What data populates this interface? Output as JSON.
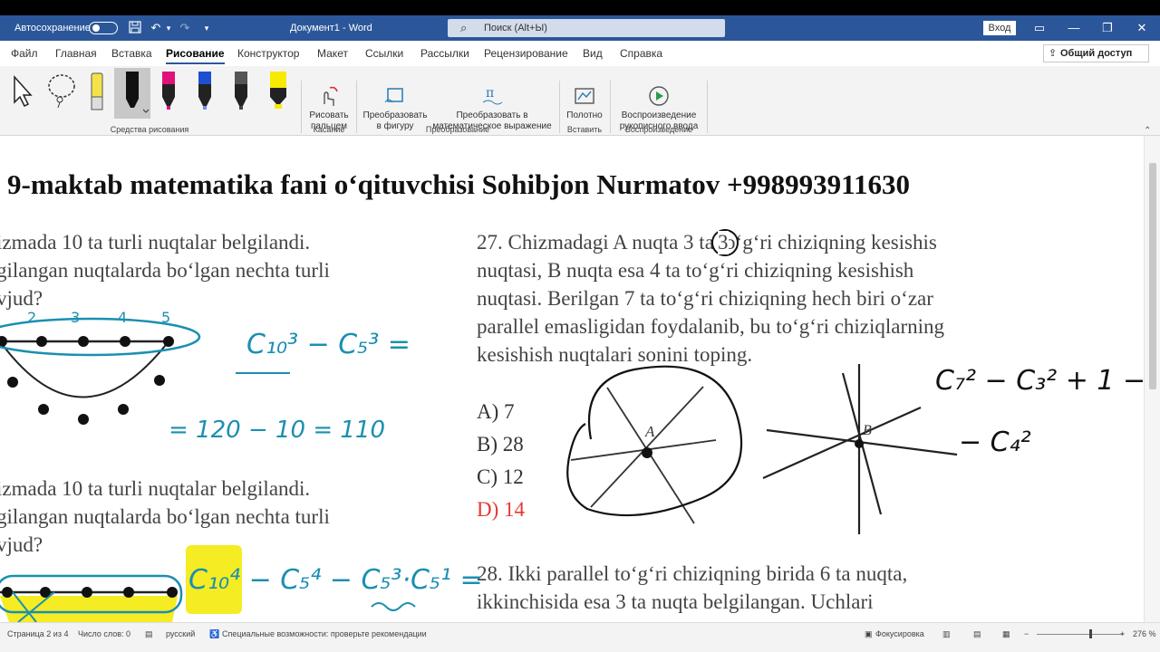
{
  "titlebar": {
    "autosave_label": "Автосохранение",
    "doc_title": "Документ1  -  Word",
    "search_placeholder": "Поиск (Alt+Ы)",
    "signin_label": "Вход"
  },
  "tabs": [
    "Файл",
    "Главная",
    "Вставка",
    "Рисование",
    "Конструктор",
    "Макет",
    "Ссылки",
    "Рассылки",
    "Рецензирование",
    "Вид",
    "Справка"
  ],
  "active_tab": "Рисование",
  "share_label": "Общий доступ",
  "ribbon": {
    "group_drawing_tools": "Средства рисования",
    "draw_with_finger": "Рисовать\nпальцем",
    "group_touch": "Касание",
    "convert_to_shape": "Преобразовать\nв фигуру",
    "convert_to_math": "Преобразовать в\nматематическое выражение",
    "group_convert": "Преобразование",
    "canvas_label": "Полотно",
    "group_insert": "Вставить",
    "ink_replay": "Воспроизведение\nрукописного ввода",
    "group_replay": "Воспроизведение",
    "pen_colors": [
      "#f3e24a",
      "#111111",
      "#e0117a",
      "#1e4fd1",
      "#222222",
      "#f7ea00"
    ]
  },
  "document": {
    "heading": "9-maktab matematika fani o‘qituvchisi Sohibjon Nurmatov +998993911630",
    "left_q1_lines": [
      "izmada 10 ta turli nuqtalar belgilandi.",
      "gilangan nuqtalarda bo‘lgan nechta turli",
      "vjud?"
    ],
    "left_q2_lines": [
      "izmada 10 ta turli nuqtalar belgilandi.",
      "gilangan nuqtalarda bo‘lgan nechta turli",
      "vjud?"
    ],
    "q27_lines": [
      "27. Chizmadagi A nuqta 3 ta to‘g‘ri chiziqning kesishis",
      "nuqtasi, B nuqta esa 4 ta to‘g‘ri chiziqning kesishish",
      "nuqtasi. Berilgan 7 ta to‘g‘ri chiziqning hech biri o‘zar",
      "parallel emasligidan foydalanib, bu to‘g‘ri chiziqlarning",
      "kesishish nuqtalari sonini toping."
    ],
    "answers": [
      "A) 7",
      "B) 28",
      "C) 12",
      "D) 14"
    ],
    "q28_lines": [
      "28. Ikki parallel to‘g‘ri chiziqning birida 6 ta nuqta,",
      "ikkinchisida esa 3 ta nuqta belgilangan. Uchlari"
    ],
    "figure_label_a": "A",
    "figure_label_b": "B",
    "diagram_numbers": [
      "2",
      "3",
      "4",
      "5"
    ],
    "ink_text": {
      "left_formula": "C₁₀³ − C₅³ =",
      "left_result": "= 120 − 10 = 110",
      "bottom_formula": "C₁₀⁴ − C₅⁴ − C₅³·C₅¹ =",
      "right_formula_1": "C₇² − C₃² + 1 −",
      "right_formula_2": "− C₄²",
      "circled_number": "3"
    }
  },
  "statusbar": {
    "page": "Страница 2 из 4",
    "words": "Число слов: 0",
    "language": "русский",
    "accessibility": "Специальные возможности: проверьте рекомендации",
    "focus": "Фокусировка",
    "zoom": "276 %"
  }
}
